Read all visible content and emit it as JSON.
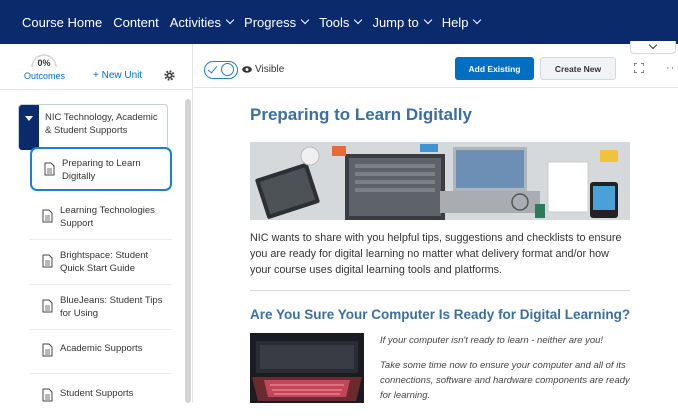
{
  "topnav": {
    "items": [
      {
        "label": "Course Home",
        "dropdown": false
      },
      {
        "label": "Content",
        "dropdown": false
      },
      {
        "label": "Activities",
        "dropdown": true
      },
      {
        "label": "Progress",
        "dropdown": true
      },
      {
        "label": "Tools",
        "dropdown": true
      },
      {
        "label": "Jump to",
        "dropdown": true
      },
      {
        "label": "Help",
        "dropdown": true
      }
    ],
    "background": "#0b2a6b"
  },
  "sidebar": {
    "outcomes_percent": "0%",
    "outcomes_label": "Outcomes",
    "new_unit_label": "+ New Unit",
    "unit": {
      "label": "NIC Technology, Academic & Student Supports",
      "expanded": true
    },
    "topics": [
      {
        "label": "Preparing to Learn Digitally",
        "active": true
      },
      {
        "label": "Learning Technologies Support",
        "active": false
      },
      {
        "label": "Brightspace: Student Quick Start Guide",
        "active": false
      },
      {
        "label": "BlueJeans: Student Tips for Using",
        "active": false
      },
      {
        "label": "Academic Supports",
        "active": false
      },
      {
        "label": "Student Supports",
        "active": false
      }
    ]
  },
  "toolbar": {
    "visibility_label": "Visible",
    "visibility_on": true,
    "add_existing_label": "Add Existing",
    "create_new_label": "Create New"
  },
  "main": {
    "title": "Preparing to Learn Digitally",
    "intro": "NIC wants to share with you helpful tips, suggestions and checklists to ensure you are ready for digital learning no matter what delivery format and/or how your course uses digital learning tools and platforms.",
    "section_title": "Are You Sure Your Computer Is Ready for Digital Learning?",
    "italic_1": "If your computer isn't ready to learn - neither are you!",
    "italic_2": "Take some time now to ensure your computer and all of its connections, software and hardware components are ready for learning."
  },
  "colors": {
    "accent": "#006fbf",
    "heading": "#3b6fa0",
    "active_border": "#1d7fd0"
  }
}
